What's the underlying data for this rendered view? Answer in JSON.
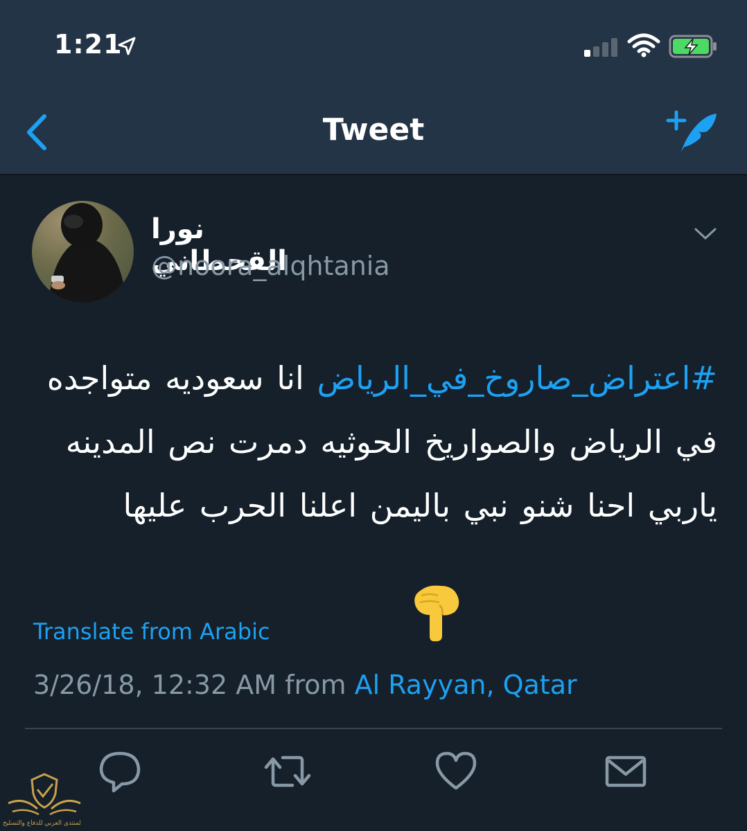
{
  "status_bar": {
    "time": "1:21",
    "icons": [
      "location-arrow-icon",
      "signal-icon",
      "wifi-icon",
      "battery-charging-icon"
    ]
  },
  "nav": {
    "title": "Tweet",
    "back_icon": "chevron-left-icon",
    "compose_icon": "compose-tweet-icon"
  },
  "tweet": {
    "author_name": "نورا القحطاني",
    "author_handle": "@noora_alqhtania",
    "hashtag": "#اعتراض_صاروخ_في_الرياض",
    "body": " انا سعوديه متواجده في الرياض والصواريخ الحوثيه دمرت نص المدينه ياربي احنا شنو نبي باليمن اعلنا الحرب عليها",
    "emoji": "👇",
    "translate_label": "Translate from Arabic",
    "timestamp": "3/26/18, 12:32 AM from ",
    "location": "Al Rayyan, Qatar"
  },
  "actions": [
    {
      "name": "reply",
      "icon": "reply-icon"
    },
    {
      "name": "retweet",
      "icon": "retweet-icon"
    },
    {
      "name": "like",
      "icon": "heart-icon"
    },
    {
      "name": "share",
      "icon": "mail-icon"
    }
  ],
  "watermark": {
    "text": "المنتدى العربي للدفاع والتسليح"
  },
  "colors": {
    "background": "#15202b",
    "header": "#243447",
    "accent": "#1da1f2",
    "secondary_text": "#8899a6",
    "battery": "#4cd964"
  }
}
